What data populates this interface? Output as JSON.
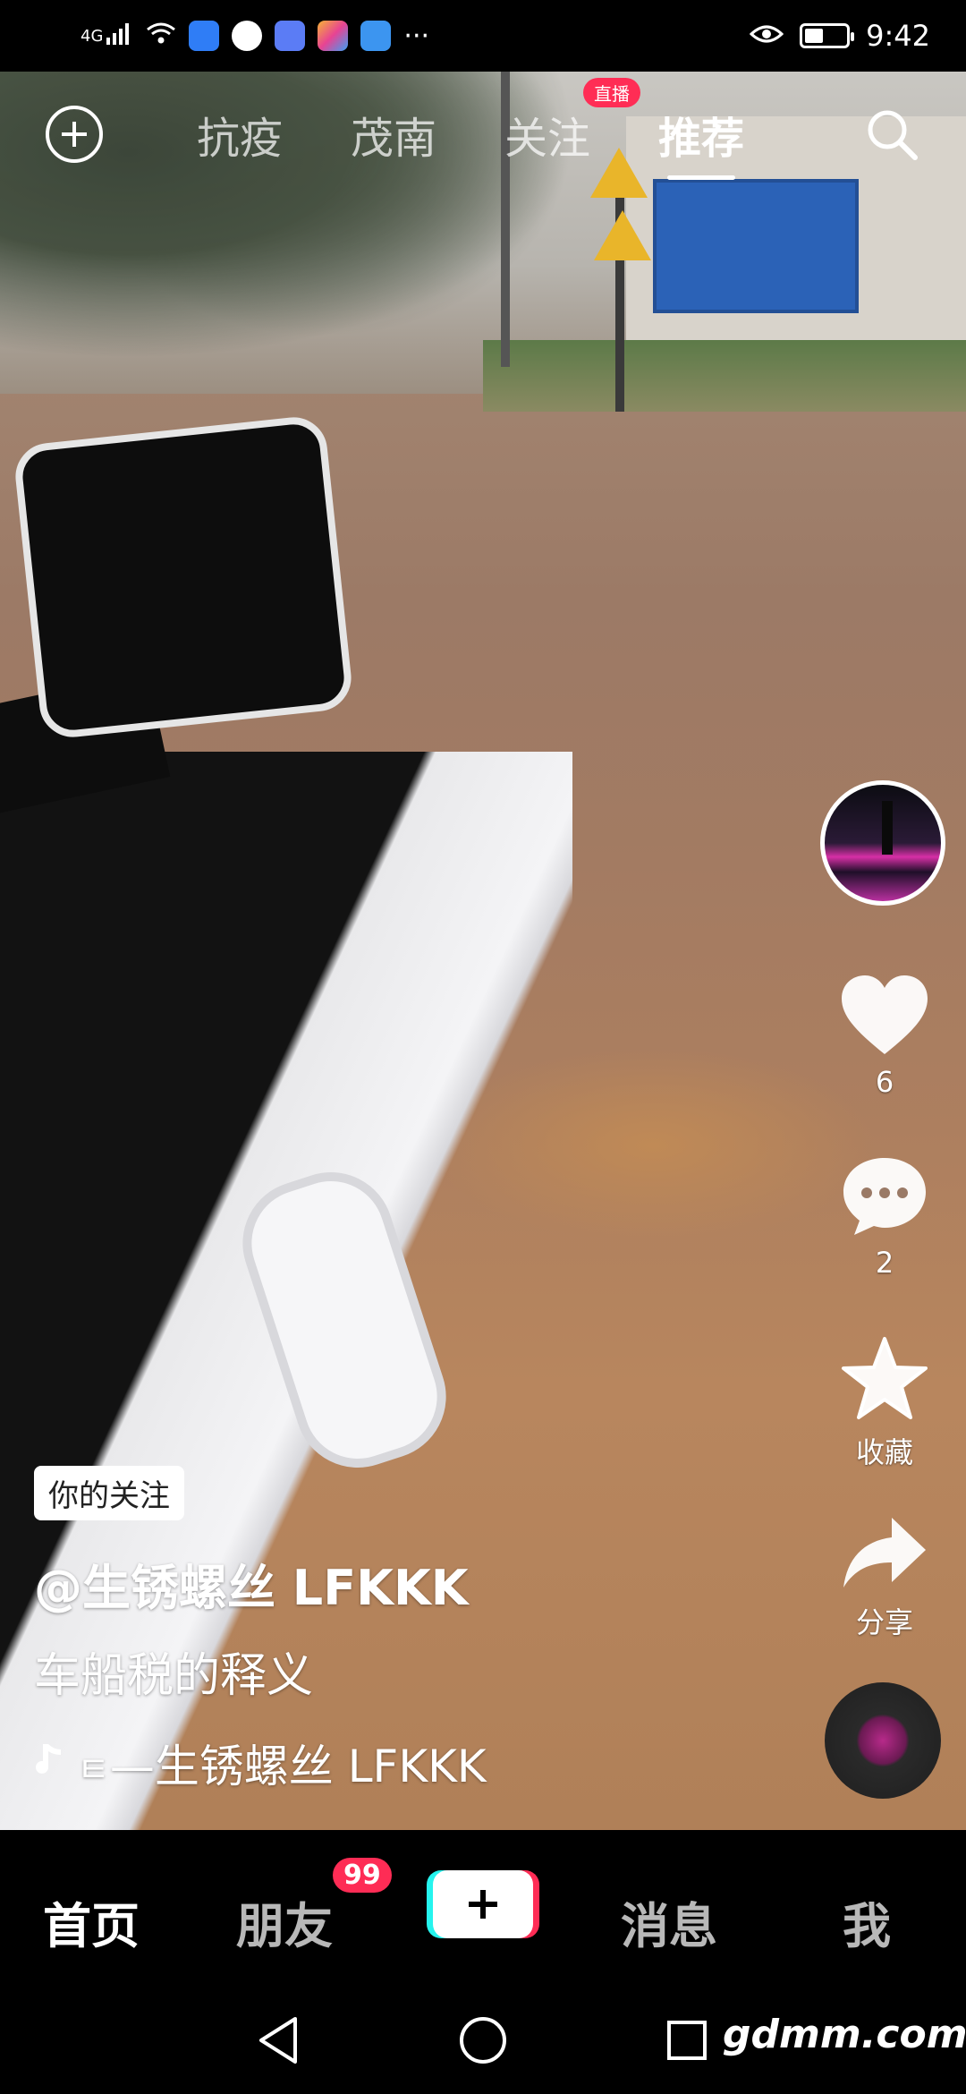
{
  "status_bar": {
    "network": "4G",
    "time": "9:42",
    "battery_level": 0.45,
    "more_indicator": "···",
    "icons": [
      "signal-icon",
      "wifi-icon",
      "shield-app-icon",
      "browser-app-icon",
      "music-app-icon",
      "gallery-app-icon",
      "weather-app-icon",
      "eye-icon",
      "battery-icon"
    ]
  },
  "top_tabs": {
    "items": [
      "抗疫",
      "茂南",
      "关注",
      "推荐"
    ],
    "active": "推荐",
    "live_badge": "直播",
    "left_icon": "add-circle-icon",
    "right_icon": "search-icon"
  },
  "actions": {
    "likes": "6",
    "comments": "2",
    "favorite_label": "收藏",
    "share_label": "分享"
  },
  "caption": {
    "follow_tag": "你的关注",
    "author": "@生锈螺丝 LFKKK",
    "description": "车船税的释义",
    "music": "—生锈螺丝 LFKKK"
  },
  "bottom_nav": {
    "home": "首页",
    "friends": "朋友",
    "friends_badge": "99",
    "messages": "消息",
    "me": "我"
  },
  "watermark": "gdmm.com",
  "colors": {
    "accent_red": "#fe2c55",
    "accent_cyan": "#25f4ee",
    "badge_pink": "#ff2d55"
  }
}
